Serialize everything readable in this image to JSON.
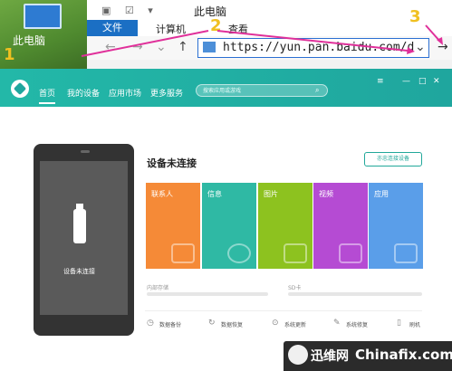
{
  "explorer": {
    "desktop_label": "此电脑",
    "window_title": "此电脑",
    "tabs": [
      "文件",
      "计算机",
      "查看"
    ],
    "address": "https://yun.pan.baidu.com/d",
    "steps": [
      "1",
      "2",
      "3"
    ]
  },
  "app": {
    "nav": [
      "首页",
      "我的设备",
      "应用市场",
      "更多服务"
    ],
    "search_placeholder": "搜索应用或游戏",
    "window_controls": [
      "≡",
      "—",
      "□",
      "✕"
    ],
    "phone_status": "设备未连接",
    "status_title": "设备未连接",
    "help_button": "亦忠连接设备",
    "cards": [
      {
        "label": "联系人",
        "color": "#f58a37"
      },
      {
        "label": "信息",
        "color": "#2fb9a4"
      },
      {
        "label": "图片",
        "color": "#8dc21f"
      },
      {
        "label": "视频",
        "color": "#b54bd3"
      },
      {
        "label": "应用",
        "color": "#5a9ee9"
      }
    ],
    "storage": {
      "internal": "内部存储",
      "sd": "SD卡"
    },
    "tools": [
      "数据备份",
      "数据恢复",
      "系统更新",
      "系统修复",
      "刷机"
    ]
  },
  "watermark": {
    "cn": "迅维网",
    "en": "Chinafix.com"
  },
  "colors": {
    "header": "#1fa69e",
    "arrow": "#e0309a"
  }
}
